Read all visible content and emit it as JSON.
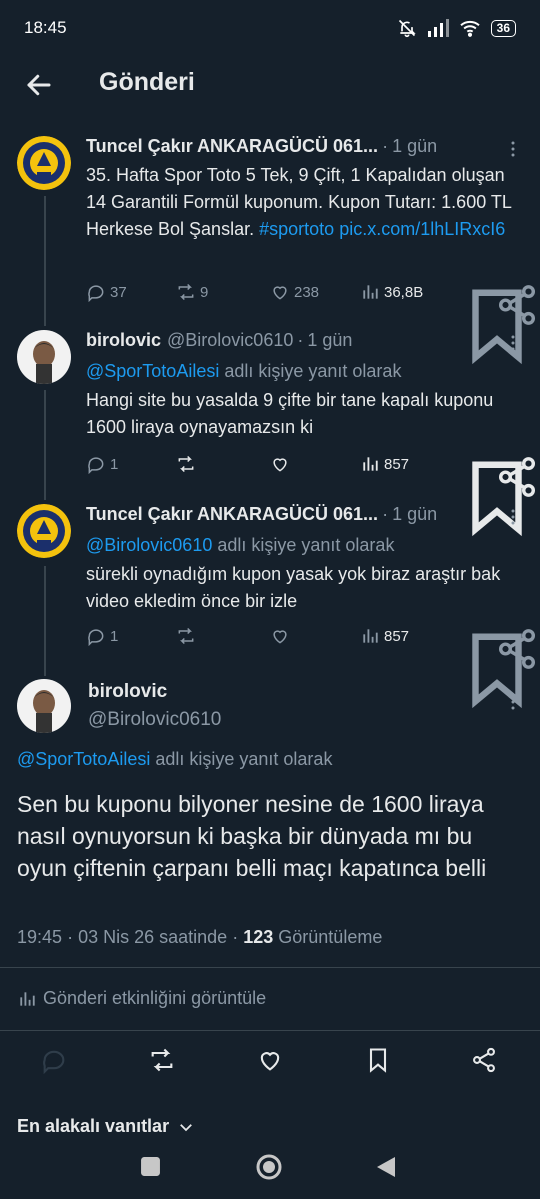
{
  "status_bar": {
    "time": "18:45",
    "battery": "36"
  },
  "header": {
    "title": "Gönderi"
  },
  "tweets": [
    {
      "name": "Tuncel Çakır ANKARAGÜCÜ 061...",
      "handle": "",
      "time": "1 gün",
      "text": "35. Hafta Spor Toto 5 Tek, 9 Çift, 1 Kapalıdan oluşan 14 Garantili Formül kuponum. Kupon Tutarı: 1.600 TL Herkese Bol Şanslar.",
      "hashtag": "#sportoto",
      "link": "pic.x.com/1lhLIRxcI6",
      "reply_count": "37",
      "retweet_count": "9",
      "like_count": "238",
      "view_count": "36,8B"
    },
    {
      "name": "birolovic",
      "handle": "@Birolovic0610",
      "time": "1 gün",
      "reply_to": "@SporTotoAilesi",
      "reply_suffix": "adlı kişiye yanıt olarak",
      "text": "Hangi site bu yasalda 9 çifte bir tane kapalı kuponu 1600 liraya oynayamazsın ki",
      "reply_count": "1",
      "view_count": "857"
    },
    {
      "name": "Tuncel Çakır ANKARAGÜCÜ 061...",
      "time": "1 gün",
      "reply_to": "@Birolovic0610",
      "reply_suffix": "adlı kişiye yanıt olarak",
      "text": "sürekli oynadığım kupon yasak yok biraz araştır bak video ekledim önce bir izle",
      "reply_count": "1",
      "view_count": "857"
    }
  ],
  "main_tweet": {
    "name": "birolovic",
    "handle": "@Birolovic0610",
    "reply_to": "@SporTotoAilesi",
    "reply_suffix": "adlı kişiye yanıt olarak",
    "text": "Sen bu kuponu bilyoner nesine de 1600 liraya  nasıl oynuyorsun ki başka bir dünyada mı bu oyun çiftenin çarpanı belli maçı kapatınca belli",
    "time": "19:45",
    "date": "03 Nis 26 saatinde",
    "views": "123",
    "views_label": "Görüntüleme"
  },
  "activity_label": "Gönderi etkinliğini görüntüle",
  "sort_label": "En alakalı vanıtlar",
  "colors": {
    "background": "#15202b",
    "accent": "#1d9bf0",
    "muted": "#8b98a5"
  }
}
